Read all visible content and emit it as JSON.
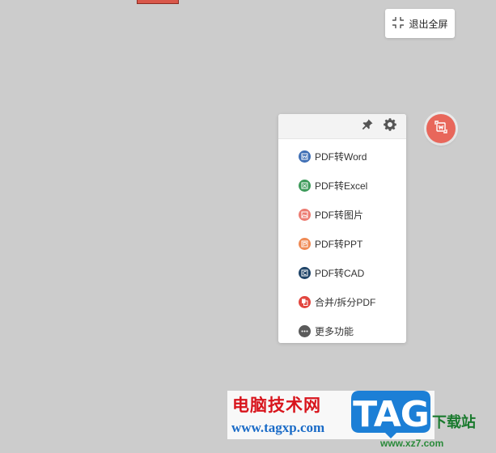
{
  "toolbar": {
    "exit_fullscreen_label": "退出全屏"
  },
  "panel": {
    "items": [
      {
        "label": "PDF转Word",
        "icon": "pdf-to-word-icon",
        "color": "#3f6fb5"
      },
      {
        "label": "PDF转Excel",
        "icon": "pdf-to-excel-icon",
        "color": "#3d9a5a"
      },
      {
        "label": "PDF转图片",
        "icon": "pdf-to-image-icon",
        "color": "#ec7c72"
      },
      {
        "label": "PDF转PPT",
        "icon": "pdf-to-ppt-icon",
        "color": "#ef8a54"
      },
      {
        "label": "PDF转CAD",
        "icon": "pdf-to-cad-icon",
        "color": "#1f4468"
      },
      {
        "label": "合并/拆分PDF",
        "icon": "merge-split-pdf-icon",
        "color": "#e2463f"
      },
      {
        "label": "更多功能",
        "icon": "more-icon",
        "color": "#5a5a5a"
      }
    ]
  },
  "watermark": {
    "title": "电脑技术网",
    "url": "www.tagxp.com",
    "logo_text": "TAG",
    "right_text": "下载站",
    "right_url": "www.xz7.com"
  },
  "colors": {
    "background": "#cccccc",
    "accent_red": "#e8675b",
    "watermark_red": "#d8141c",
    "watermark_blue": "#1a6bc7",
    "logo_blue": "#1c7fd6"
  }
}
